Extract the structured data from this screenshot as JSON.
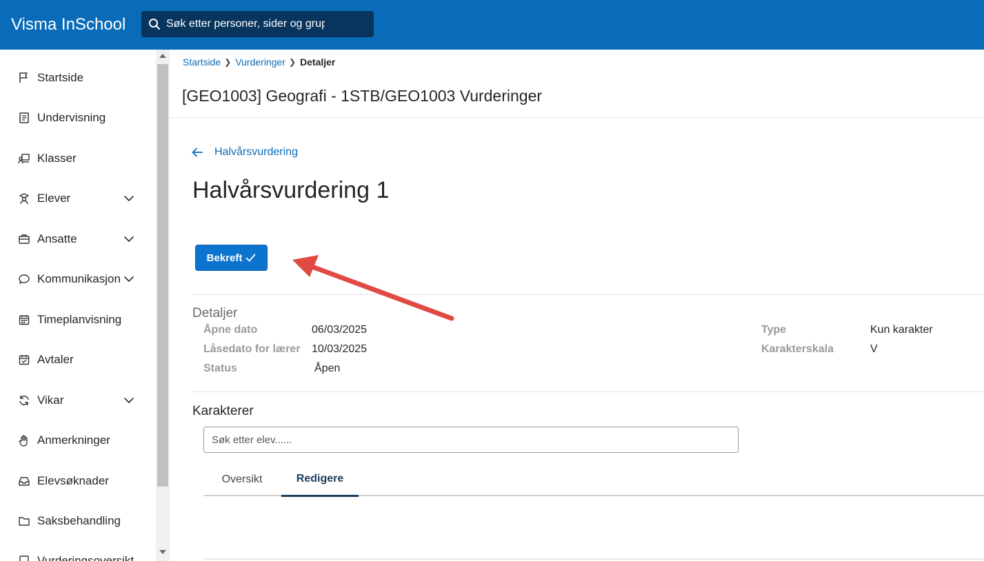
{
  "app": {
    "title": "Visma InSchool",
    "search_placeholder": "Søk etter personer, sider og grupper"
  },
  "sidebar": {
    "items": [
      {
        "label": "Startside",
        "icon": "flag-icon",
        "expandable": false
      },
      {
        "label": "Undervisning",
        "icon": "book-icon",
        "expandable": false
      },
      {
        "label": "Klasser",
        "icon": "classroom-icon",
        "expandable": false
      },
      {
        "label": "Elever",
        "icon": "student-icon",
        "expandable": true
      },
      {
        "label": "Ansatte",
        "icon": "briefcase-icon",
        "expandable": true
      },
      {
        "label": "Kommunikasjon",
        "icon": "chat-icon",
        "expandable": true
      },
      {
        "label": "Timeplanvisning",
        "icon": "calendar-icon",
        "expandable": false
      },
      {
        "label": "Avtaler",
        "icon": "calendar-check-icon",
        "expandable": false
      },
      {
        "label": "Vikar",
        "icon": "refresh-icon",
        "expandable": true
      },
      {
        "label": "Anmerkninger",
        "icon": "hand-icon",
        "expandable": false
      },
      {
        "label": "Elevsøknader",
        "icon": "inbox-icon",
        "expandable": false
      },
      {
        "label": "Saksbehandling",
        "icon": "folder-icon",
        "expandable": false
      },
      {
        "label": "Vurderingsoversikt",
        "icon": "assessment-icon",
        "expandable": false
      }
    ]
  },
  "breadcrumb": {
    "items": [
      "Startside",
      "Vurderinger"
    ],
    "current": "Detaljer"
  },
  "page": {
    "title": "[GEO1003] Geografi - 1STB/GEO1003 Vurderinger",
    "back_label": "Halvårsvurdering",
    "heading": "Halvårsvurdering 1",
    "confirm_label": "Bekreft"
  },
  "details": {
    "title": "Detaljer",
    "left": [
      {
        "label": "Åpne dato",
        "value": "06/03/2025"
      },
      {
        "label": "Låsedato for lærer",
        "value": "10/03/2025"
      },
      {
        "label": "Status",
        "value": "Åpen"
      }
    ],
    "right": [
      {
        "label": "Type",
        "value": "Kun karakter"
      },
      {
        "label": "Karakterskala",
        "value": "V"
      }
    ]
  },
  "grades": {
    "title": "Karakterer",
    "search_placeholder": "Søk etter elev......",
    "tabs": [
      {
        "label": "Oversikt",
        "active": false
      },
      {
        "label": "Redigere",
        "active": true
      }
    ]
  },
  "colors": {
    "topbar": "#0a6cb8",
    "search_bg": "#08355e",
    "link": "#0a6cb8",
    "primary_button": "#0c74cf",
    "annotation_arrow": "#e04a43"
  }
}
